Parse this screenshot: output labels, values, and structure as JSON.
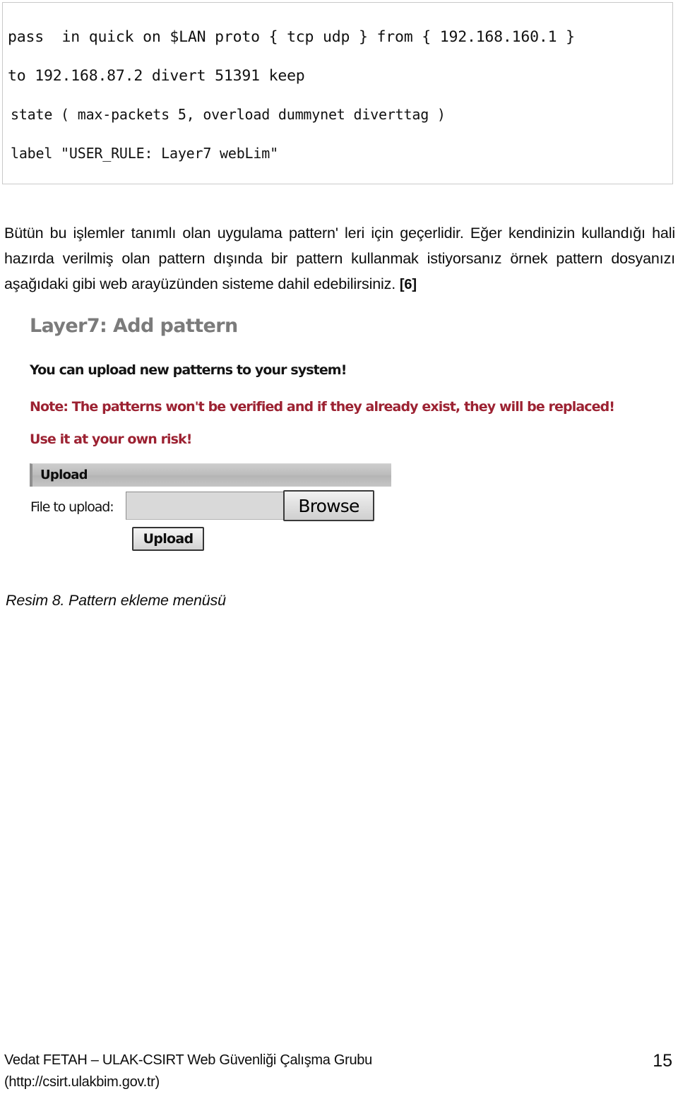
{
  "code_block": {
    "name": "pf-firewall-rule",
    "lines": [
      "pass  in quick on $LAN proto { tcp udp } from { 192.168.160.1 }",
      "to 192.168.87.2 divert 51391 keep",
      "state ( max-packets 5, overload dummynet diverttag )",
      "label \"USER_RULE: Layer7 webLim\""
    ]
  },
  "body": {
    "paragraph": "Bütün bu işlemler tanımlı olan uygulama pattern' leri için geçerlidir. Eğer kendinizin kullandığı hali hazırda verilmiş olan pattern dışında bir pattern kullanmak istiyorsanız örnek pattern dosyanızı aşağıdaki gibi web arayüzünden sisteme dahil edebilirsiniz. ",
    "reference": "[6]"
  },
  "screenshot": {
    "panel_title": "Layer7: Add pattern",
    "info_line": "You can upload new patterns to your system!",
    "warning_line_1": "Note: The patterns won't be verified and if they already exist, they will be replaced!",
    "warning_line_2": "Use it at your own risk!",
    "warning_color": "#9c2232",
    "title_color": "#7b7b7b",
    "form": {
      "header_label": "Upload",
      "file_label": "File to upload:",
      "file_input_value": "",
      "file_input_placeholder": "",
      "browse_button_label": "Browse",
      "upload_button_label": "Upload"
    }
  },
  "caption": "Resim 8. Pattern ekleme menüsü",
  "footer": {
    "text": "Vedat FETAH – ULAK-CSIRT Web Güvenliği Çalışma Grubu\n(http://csirt.ulakbim.gov.tr)",
    "page_number": "15"
  }
}
